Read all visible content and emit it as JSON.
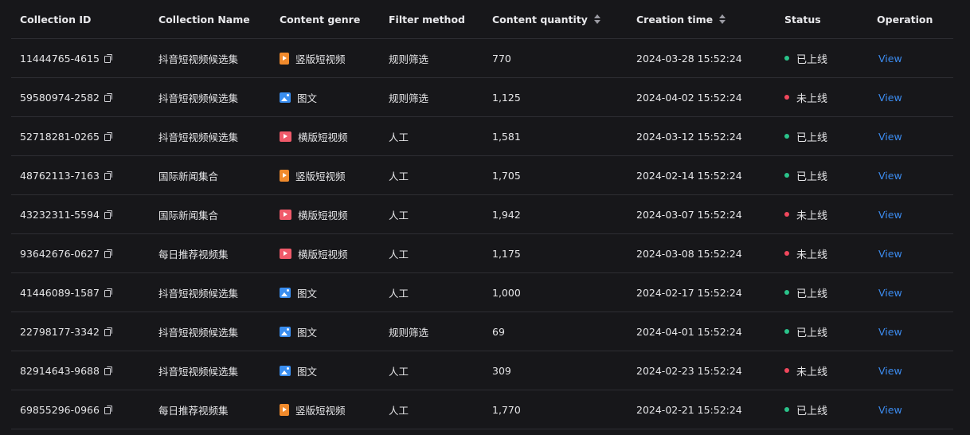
{
  "colors": {
    "background": "#17171a",
    "divider": "#2e2e33",
    "link": "#3c8cf0",
    "online": "#2ac38a",
    "offline": "#f0475c",
    "genre_vertical": "#f08a2c",
    "genre_horizontal": "#f05a6a",
    "genre_image": "#3a8ef0"
  },
  "table": {
    "headers": {
      "id": "Collection ID",
      "name": "Collection Name",
      "genre": "Content genre",
      "filter": "Filter method",
      "quantity": "Content quantity",
      "time": "Creation time",
      "status": "Status",
      "operation": "Operation"
    },
    "rows": [
      {
        "id": "11444765-4615",
        "name": "抖音短视频候选集",
        "genre": "竖版短视频",
        "genre_icon": "vertical-video-icon",
        "filter": "规则筛选",
        "quantity": "770",
        "time": "2024-03-28 15:52:24",
        "status": "已上线",
        "status_type": "online",
        "op": "View"
      },
      {
        "id": "59580974-2582",
        "name": "抖音短视频候选集",
        "genre": "图文",
        "genre_icon": "image-icon",
        "filter": "规则筛选",
        "quantity": "1,125",
        "time": "2024-04-02 15:52:24",
        "status": "未上线",
        "status_type": "offline",
        "op": "View"
      },
      {
        "id": "52718281-0265",
        "name": "抖音短视频候选集",
        "genre": "横版短视频",
        "genre_icon": "horizontal-video-icon",
        "filter": "人工",
        "quantity": "1,581",
        "time": "2024-03-12 15:52:24",
        "status": "已上线",
        "status_type": "online",
        "op": "View"
      },
      {
        "id": "48762113-7163",
        "name": "国际新闻集合",
        "genre": "竖版短视频",
        "genre_icon": "vertical-video-icon",
        "filter": "人工",
        "quantity": "1,705",
        "time": "2024-02-14 15:52:24",
        "status": "已上线",
        "status_type": "online",
        "op": "View"
      },
      {
        "id": "43232311-5594",
        "name": "国际新闻集合",
        "genre": "横版短视频",
        "genre_icon": "horizontal-video-icon",
        "filter": "人工",
        "quantity": "1,942",
        "time": "2024-03-07 15:52:24",
        "status": "未上线",
        "status_type": "offline",
        "op": "View"
      },
      {
        "id": "93642676-0627",
        "name": "每日推荐视频集",
        "genre": "横版短视频",
        "genre_icon": "horizontal-video-icon",
        "filter": "人工",
        "quantity": "1,175",
        "time": "2024-03-08 15:52:24",
        "status": "未上线",
        "status_type": "offline",
        "op": "View"
      },
      {
        "id": "41446089-1587",
        "name": "抖音短视频候选集",
        "genre": "图文",
        "genre_icon": "image-icon",
        "filter": "人工",
        "quantity": "1,000",
        "time": "2024-02-17 15:52:24",
        "status": "已上线",
        "status_type": "online",
        "op": "View"
      },
      {
        "id": "22798177-3342",
        "name": "抖音短视频候选集",
        "genre": "图文",
        "genre_icon": "image-icon",
        "filter": "规则筛选",
        "quantity": "69",
        "time": "2024-04-01 15:52:24",
        "status": "已上线",
        "status_type": "online",
        "op": "View"
      },
      {
        "id": "82914643-9688",
        "name": "抖音短视频候选集",
        "genre": "图文",
        "genre_icon": "image-icon",
        "filter": "人工",
        "quantity": "309",
        "time": "2024-02-23 15:52:24",
        "status": "未上线",
        "status_type": "offline",
        "op": "View"
      },
      {
        "id": "69855296-0966",
        "name": "每日推荐视频集",
        "genre": "竖版短视频",
        "genre_icon": "vertical-video-icon",
        "filter": "人工",
        "quantity": "1,770",
        "time": "2024-02-21 15:52:24",
        "status": "已上线",
        "status_type": "online",
        "op": "View"
      }
    ]
  }
}
